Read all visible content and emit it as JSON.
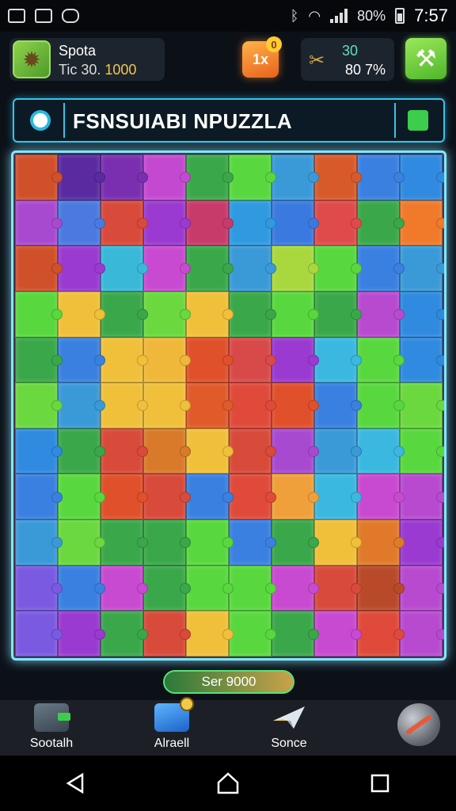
{
  "status_bar": {
    "battery_text": "80%",
    "time": "7:57"
  },
  "hud": {
    "player_name": "Spota",
    "score_label": "Tic 30.",
    "score_value": "1000",
    "chest_badge": "0",
    "chest_label": "1x",
    "stat_top": "30",
    "stat_bottom": "80 7%"
  },
  "title": {
    "text": "FSNSUIABI NPUZZLA"
  },
  "board": {
    "cols": 10,
    "rows": 11,
    "pieces": [
      "#d0502a",
      "#5a2aa0",
      "#7a2fb0",
      "#c34ad0",
      "#3aa84a",
      "#58d83e",
      "#3a9ad8",
      "#d85a2a",
      "#3a80e0",
      "#2f8ae0",
      "#a84ad0",
      "#4a7ae0",
      "#d84a3a",
      "#9a3ad0",
      "#c83a6a",
      "#2f9ae0",
      "#3a7ae0",
      "#e04a4a",
      "#3aa84a",
      "#f07a2a",
      "#d0502a",
      "#9a3ad0",
      "#3ab8d8",
      "#c84ad0",
      "#3aa84a",
      "#3a9ad8",
      "#a8d83e",
      "#58d83e",
      "#3a80e0",
      "#3a9ad8",
      "#58d83e",
      "#f0c03a",
      "#3aa84a",
      "#6ad83e",
      "#f0c03a",
      "#3aa84a",
      "#58d83e",
      "#3aa84a",
      "#b84ad0",
      "#2f8ae0",
      "#3aa84a",
      "#3a80e0",
      "#f0c03a",
      "#f0b83a",
      "#e0502a",
      "#d84a4a",
      "#9a3ad0",
      "#3ab8e0",
      "#58d83e",
      "#2f8ae0",
      "#6ad83e",
      "#3a9ad8",
      "#f0c03a",
      "#f0c03a",
      "#e05a2a",
      "#e04a3a",
      "#e0502a",
      "#3a80e0",
      "#58d83e",
      "#6ad83e",
      "#2f8ae0",
      "#3aa84a",
      "#d84a3a",
      "#d87a2a",
      "#f0c03a",
      "#d84a3a",
      "#a84ad0",
      "#3a9ad8",
      "#3ab8e0",
      "#58d83e",
      "#3a80e0",
      "#58d83e",
      "#e0502a",
      "#d84a3a",
      "#3a80e0",
      "#e04a3a",
      "#f0a03a",
      "#3ab8e0",
      "#c84ad0",
      "#b84ad0",
      "#3a9ad8",
      "#6ad83e",
      "#3aa84a",
      "#3aa84a",
      "#58d83e",
      "#3a80e0",
      "#3aa84a",
      "#f0c03a",
      "#e07a2a",
      "#9a3ad0",
      "#7a5ae0",
      "#3a80e0",
      "#c84ad0",
      "#3aa84a",
      "#58d83e",
      "#58d83e",
      "#c84ad0",
      "#d84a3a",
      "#b84a2a",
      "#b84ad0",
      "#7a5ae0",
      "#9a3ad0",
      "#3aa84a",
      "#d84a3a",
      "#f0c03a",
      "#58d83e",
      "#3aa84a",
      "#c84ad0",
      "#e04a3a",
      "#b84ad0"
    ]
  },
  "score_pill": {
    "text": "Ser 9000"
  },
  "bottom_nav": {
    "items": [
      {
        "label": "Sootalh",
        "icon": "shop-icon"
      },
      {
        "label": "Alraell",
        "icon": "cube-icon"
      },
      {
        "label": "Sonce",
        "icon": "plane-icon"
      },
      {
        "label": "",
        "icon": "globe-icon"
      }
    ]
  }
}
